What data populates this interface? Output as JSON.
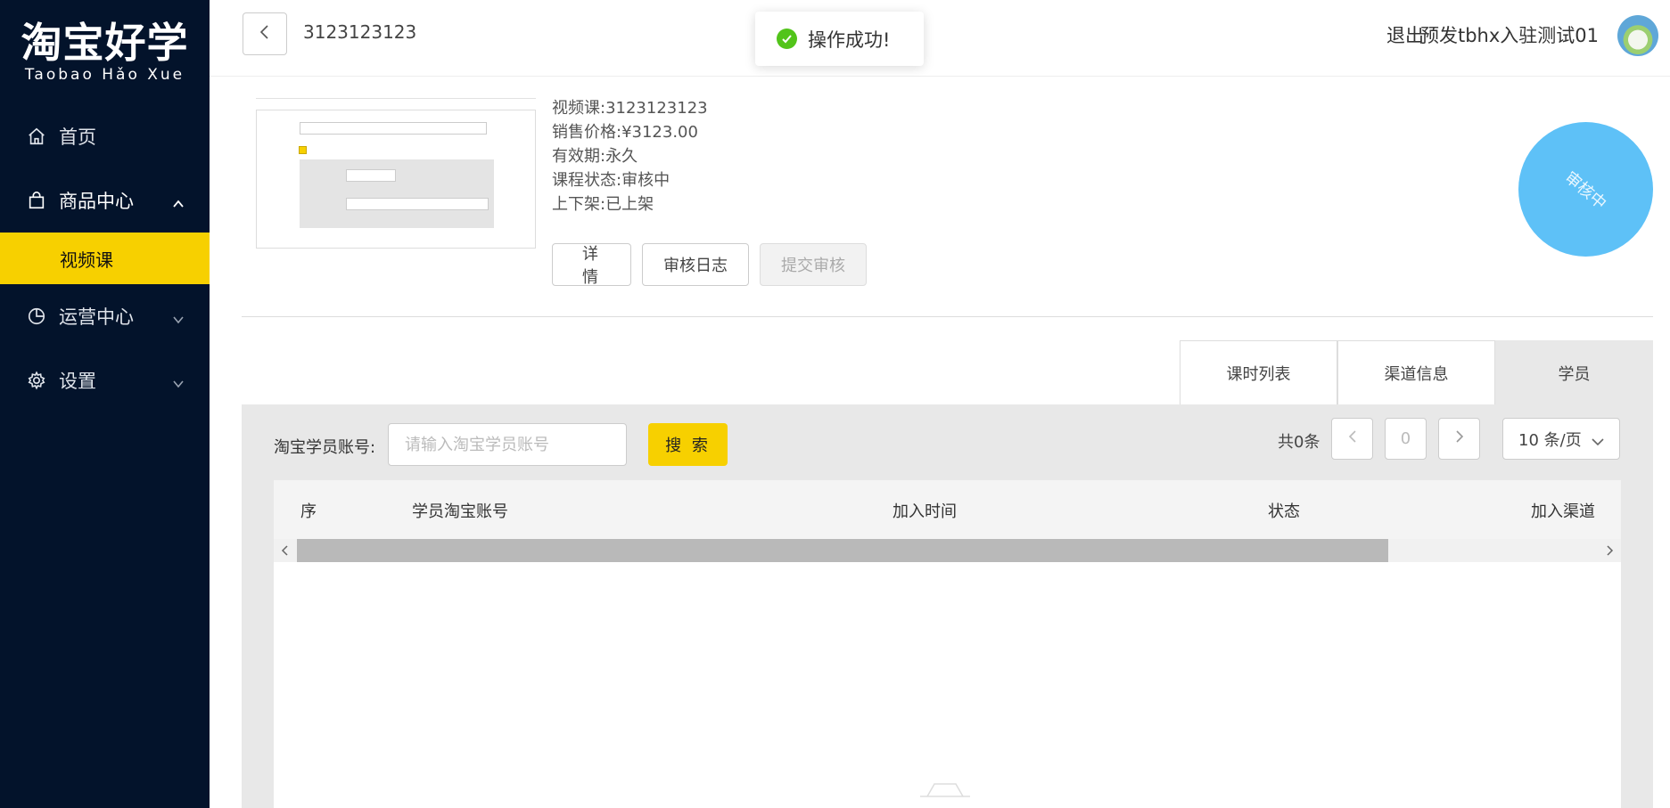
{
  "sidebar": {
    "logo_cn": "淘宝好学",
    "logo_en": "Taobao Hǎo Xue",
    "items": [
      {
        "label": "首页",
        "icon": "home-icon"
      },
      {
        "label": "商品中心",
        "icon": "bag-icon",
        "expanded": true,
        "children": [
          {
            "label": "视频课",
            "active": true
          }
        ]
      },
      {
        "label": "运营中心",
        "icon": "pie-chart-icon"
      },
      {
        "label": "设置",
        "icon": "gear-icon"
      }
    ]
  },
  "header": {
    "title": "3123123123",
    "logout": "退出",
    "username": "预发tbhx入驻测试01"
  },
  "toast": {
    "message": "操作成功!",
    "color": "#52c41a"
  },
  "course": {
    "name_label": "视频课:",
    "name": "3123123123",
    "price_label": "销售价格:",
    "price": "¥3123.00",
    "validity_label": "有效期:",
    "validity": "永久",
    "status_label": "课程状态:",
    "status": "审核中",
    "listing_label": "上下架:",
    "listing": "已上架",
    "status_stamp": "审核中"
  },
  "actions": {
    "detail": "详 情",
    "audit_log": "审核日志",
    "submit_audit": "提交审核"
  },
  "tabs": [
    {
      "label": "课时列表",
      "active": false
    },
    {
      "label": "渠道信息",
      "active": false
    },
    {
      "label": "学员",
      "active": true
    }
  ],
  "search": {
    "label": "淘宝学员账号:",
    "placeholder": "请输入淘宝学员账号",
    "button": "搜 索"
  },
  "pagination": {
    "total": "共0条",
    "current": "0",
    "page_size": "10 条/页"
  },
  "table": {
    "columns": [
      "序",
      "学员淘宝账号",
      "加入时间",
      "状态",
      "加入渠道"
    ],
    "rows": []
  },
  "colors": {
    "sidebar_bg": "#03132b",
    "accent": "#f7d000",
    "status_circle": "#5ec1f7"
  }
}
